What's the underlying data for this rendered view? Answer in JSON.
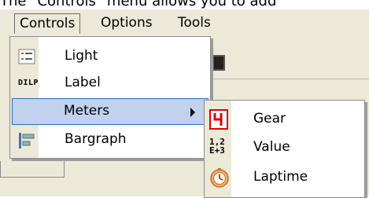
{
  "caption": "The \"Controls\" menu allows you to add",
  "menubar": {
    "items": [
      {
        "label": "Controls",
        "active": true
      },
      {
        "label": "Options",
        "active": false
      },
      {
        "label": "Tools",
        "active": false
      }
    ]
  },
  "controls_menu": {
    "items": [
      {
        "label": "Light",
        "icon": "light-icon"
      },
      {
        "label": "Label",
        "icon": "label-icon",
        "icon_text": "DILP"
      },
      {
        "label": "Meters",
        "icon": "",
        "has_submenu": true,
        "highlighted": true
      },
      {
        "label": "Bargraph",
        "icon": "bargraph-icon"
      }
    ]
  },
  "meters_submenu": {
    "items": [
      {
        "label": "Gear",
        "icon": "gear-digit-icon",
        "icon_text": "4"
      },
      {
        "label": "Value",
        "icon": "value-icon",
        "icon_text_top": "1,2",
        "icon_text_bottom": "E+3"
      },
      {
        "label": "Laptime",
        "icon": "stopwatch-icon"
      }
    ]
  },
  "colors": {
    "menu_bg": "#ece9d8",
    "highlight_bg": "#c1d2ee",
    "highlight_border": "#316ac5",
    "gear_red": "#e00000"
  }
}
